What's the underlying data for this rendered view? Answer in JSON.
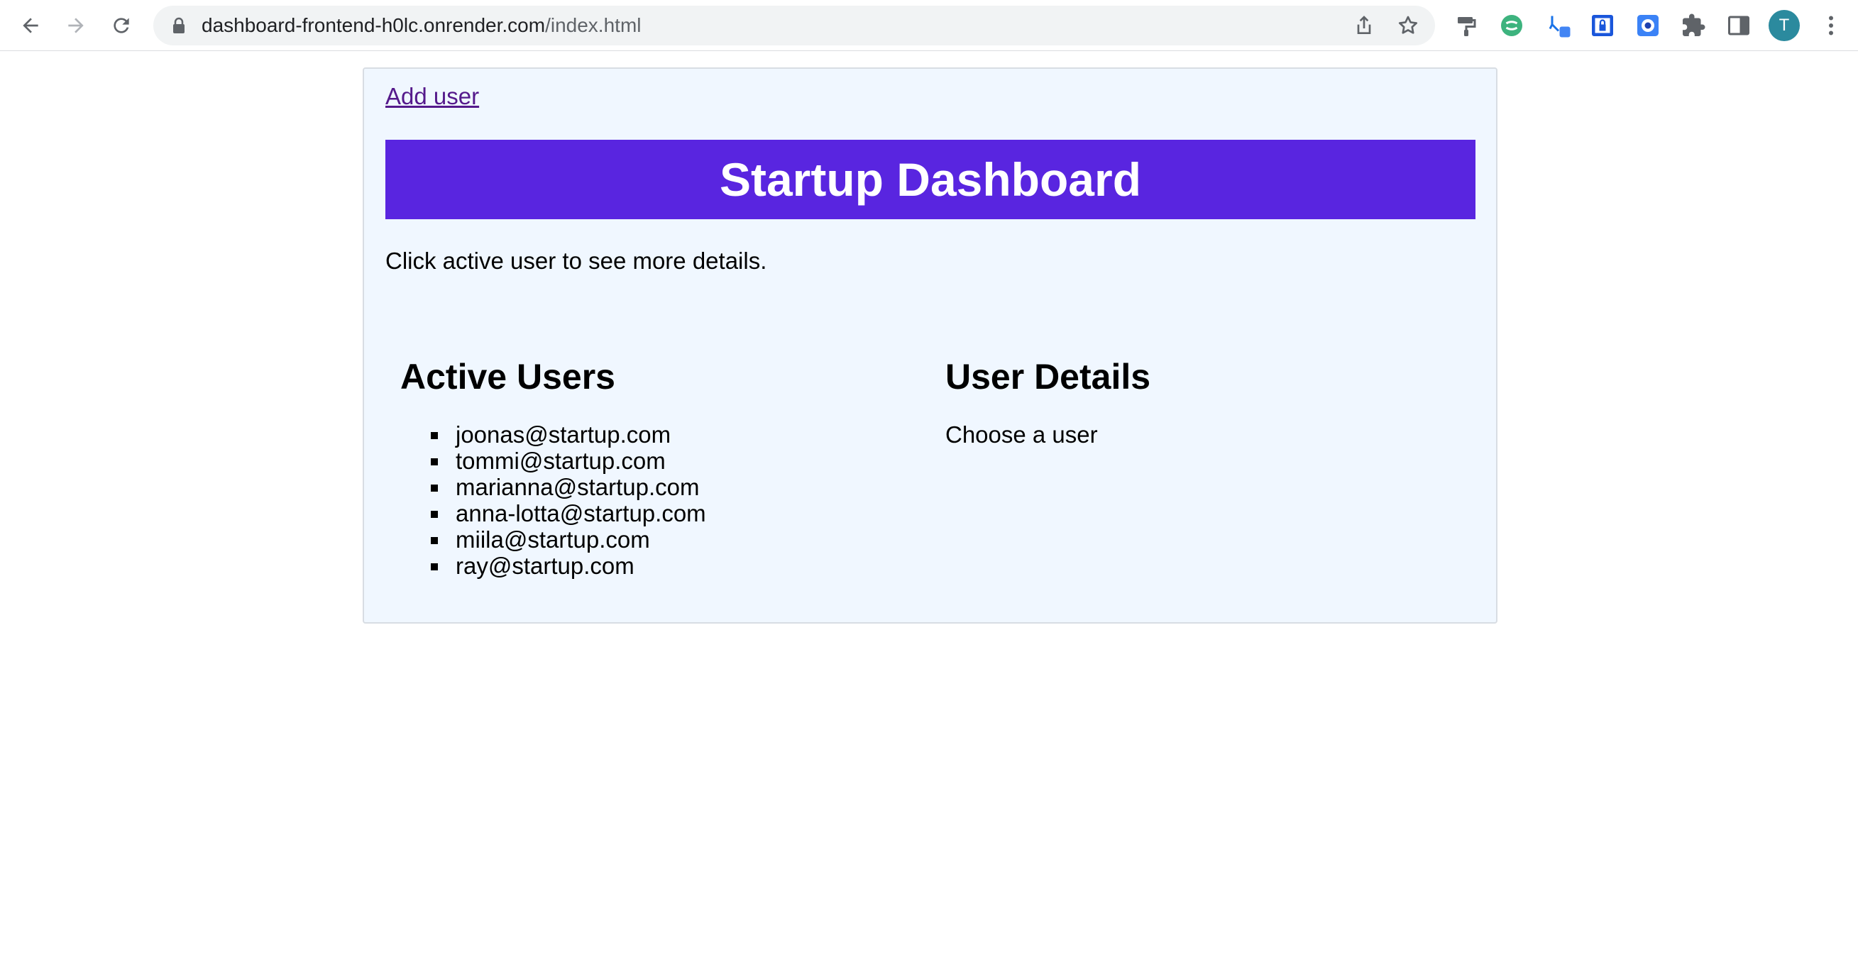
{
  "browser": {
    "url_host": "dashboard-frontend-h0lc.onrender.com",
    "url_path": "/index.html",
    "profile_initial": "T",
    "icons": [
      "back-arrow-icon",
      "forward-arrow-icon",
      "reload-icon",
      "lock-icon",
      "share-icon",
      "bookmark-star-icon",
      "extension-paint-roller-icon",
      "extension-green-circle-icon",
      "extension-blue-link-icon",
      "extension-shield-lock-icon",
      "extension-blue-eye-icon",
      "extensions-puzzle-icon",
      "side-panel-icon",
      "more-menu-icon"
    ]
  },
  "page": {
    "add_user_label": "Add user",
    "title": "Startup Dashboard",
    "hint": "Click active user to see more details.",
    "active_users_heading": "Active Users",
    "users": [
      "joonas@startup.com",
      "tommi@startup.com",
      "marianna@startup.com",
      "anna-lotta@startup.com",
      "miila@startup.com",
      "ray@startup.com"
    ],
    "details_heading": "User Details",
    "details_placeholder": "Choose a user"
  },
  "colors": {
    "header_bg": "#5925e0",
    "card_bg": "#f0f7ff",
    "link": "#551a8b",
    "avatar": "#2b8a9e"
  }
}
